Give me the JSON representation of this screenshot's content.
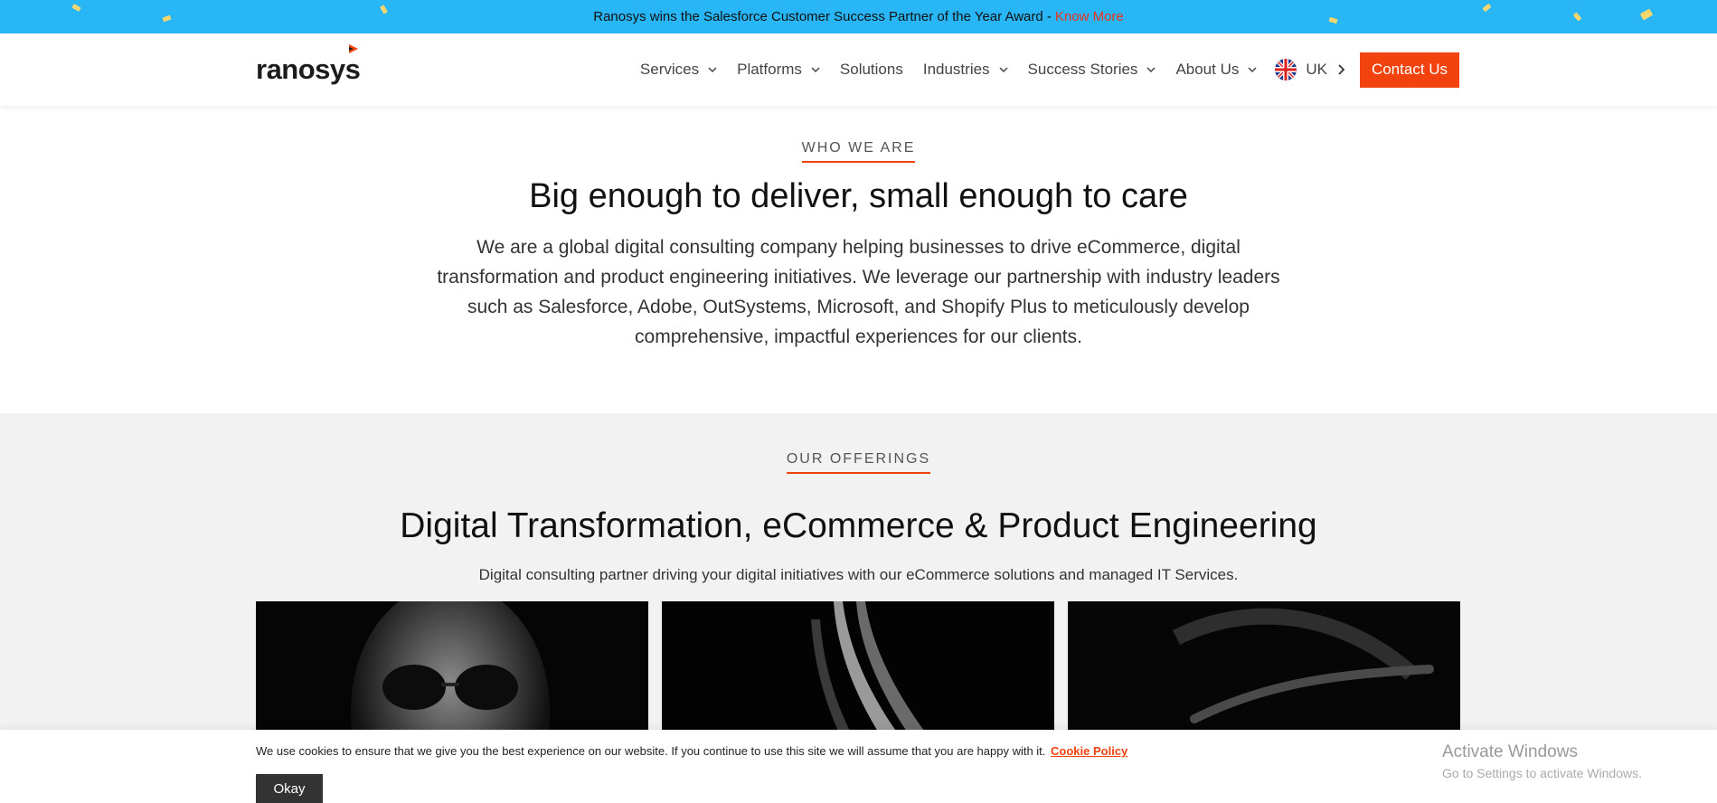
{
  "announcement": {
    "text": "Ranosys wins the Salesforce Customer Success Partner of the Year Award -",
    "link": "Know More"
  },
  "header": {
    "logo": "ranosys",
    "nav": [
      {
        "label": "Services",
        "dropdown": true
      },
      {
        "label": "Platforms",
        "dropdown": true
      },
      {
        "label": "Solutions",
        "dropdown": false
      },
      {
        "label": "Industries",
        "dropdown": true
      },
      {
        "label": "Success Stories",
        "dropdown": true
      },
      {
        "label": "About Us",
        "dropdown": true
      }
    ],
    "region": "UK",
    "contact": "Contact Us"
  },
  "who": {
    "eyebrow": "WHO WE ARE",
    "title": "Big enough to deliver, small enough to care",
    "body": "We are a global digital consulting company helping businesses to drive eCommerce, digital transformation and product engineering initiatives. We leverage our partnership with industry leaders such as Salesforce, Adobe, OutSystems, Microsoft, and Shopify Plus to meticulously develop comprehensive, impactful experiences for our clients."
  },
  "offerings": {
    "eyebrow": "OUR OFFERINGS",
    "title": "Digital Transformation, eCommerce & Product Engineering",
    "subtitle": "Digital consulting partner driving your digital initiatives with our eCommerce solutions and managed IT Services."
  },
  "cookie": {
    "message": "We use cookies to ensure that we give you the best experience on our website. If you continue to use this site we will assume that you are happy with it.",
    "policy_link": "Cookie Policy",
    "ok": "Okay"
  },
  "windows": {
    "line1": "Activate Windows",
    "line2": "Go to Settings to activate Windows."
  },
  "colors": {
    "banner": "#29b6f6",
    "accent": "#f2420d",
    "section_bg": "#f2f2f2"
  }
}
